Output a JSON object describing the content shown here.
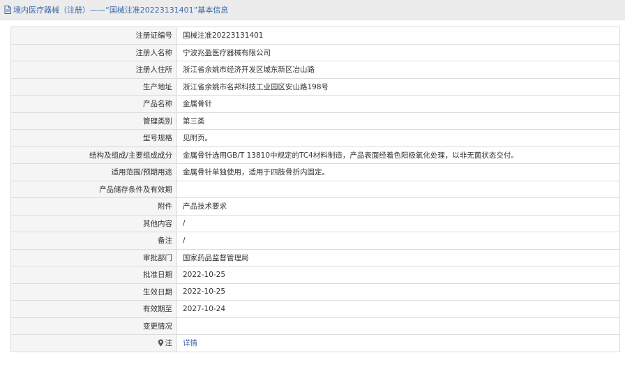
{
  "header": {
    "title": "境内医疗器械（注册）——“国械注准20223131401”基本信息",
    "icon": "document-icon"
  },
  "rows": [
    {
      "key": "registration-number",
      "label": "注册证编号",
      "value": "国械注准20223131401"
    },
    {
      "key": "registrant-name",
      "label": "注册人名称",
      "value": "宁波兆盈医疗器械有限公司"
    },
    {
      "key": "registrant-address",
      "label": "注册人住所",
      "value": "浙江省余姚市经济开发区城东新区冶山路"
    },
    {
      "key": "production-address",
      "label": "生产地址",
      "value": "浙江省余姚市名邦科技工业园区安山路198号"
    },
    {
      "key": "product-name",
      "label": "产品名称",
      "value": "金属骨针"
    },
    {
      "key": "management-category",
      "label": "管理类别",
      "value": "第三类"
    },
    {
      "key": "model-spec",
      "label": "型号规格",
      "value": "见附页。"
    },
    {
      "key": "structure-composition",
      "label": "结构及组成/主要组成成分",
      "value": "金属骨针选用GB/T 13810中规定的TC4材料制造，产品表面经着色阳极氧化处理，以非无菌状态交付。"
    },
    {
      "key": "intended-use",
      "label": "适用范围/预期用途",
      "value": "金属骨针单独使用，适用于四肢骨折内固定。"
    },
    {
      "key": "storage-conditions",
      "label": "产品储存条件及有效期",
      "value": ""
    },
    {
      "key": "attachment",
      "label": "附件",
      "value": "产品技术要求"
    },
    {
      "key": "other-content",
      "label": "其他内容",
      "value": "/"
    },
    {
      "key": "remarks",
      "label": "备注",
      "value": "/"
    },
    {
      "key": "approval-department",
      "label": "审批部门",
      "value": "国家药品监督管理局"
    },
    {
      "key": "approval-date",
      "label": "批准日期",
      "value": "2022-10-25"
    },
    {
      "key": "effective-date",
      "label": "生效日期",
      "value": "2022-10-25"
    },
    {
      "key": "expiry-date",
      "label": "有效期至",
      "value": "2027-10-24"
    },
    {
      "key": "change-status",
      "label": "变更情况",
      "value": ""
    }
  ],
  "note": {
    "label": "注",
    "link_text": "详情",
    "icon": "map-pin-icon"
  },
  "colors": {
    "link": "#3a67a8",
    "header_bg": "#ececec",
    "label_bg": "#f5f5f5",
    "border": "#dcdcdc"
  }
}
